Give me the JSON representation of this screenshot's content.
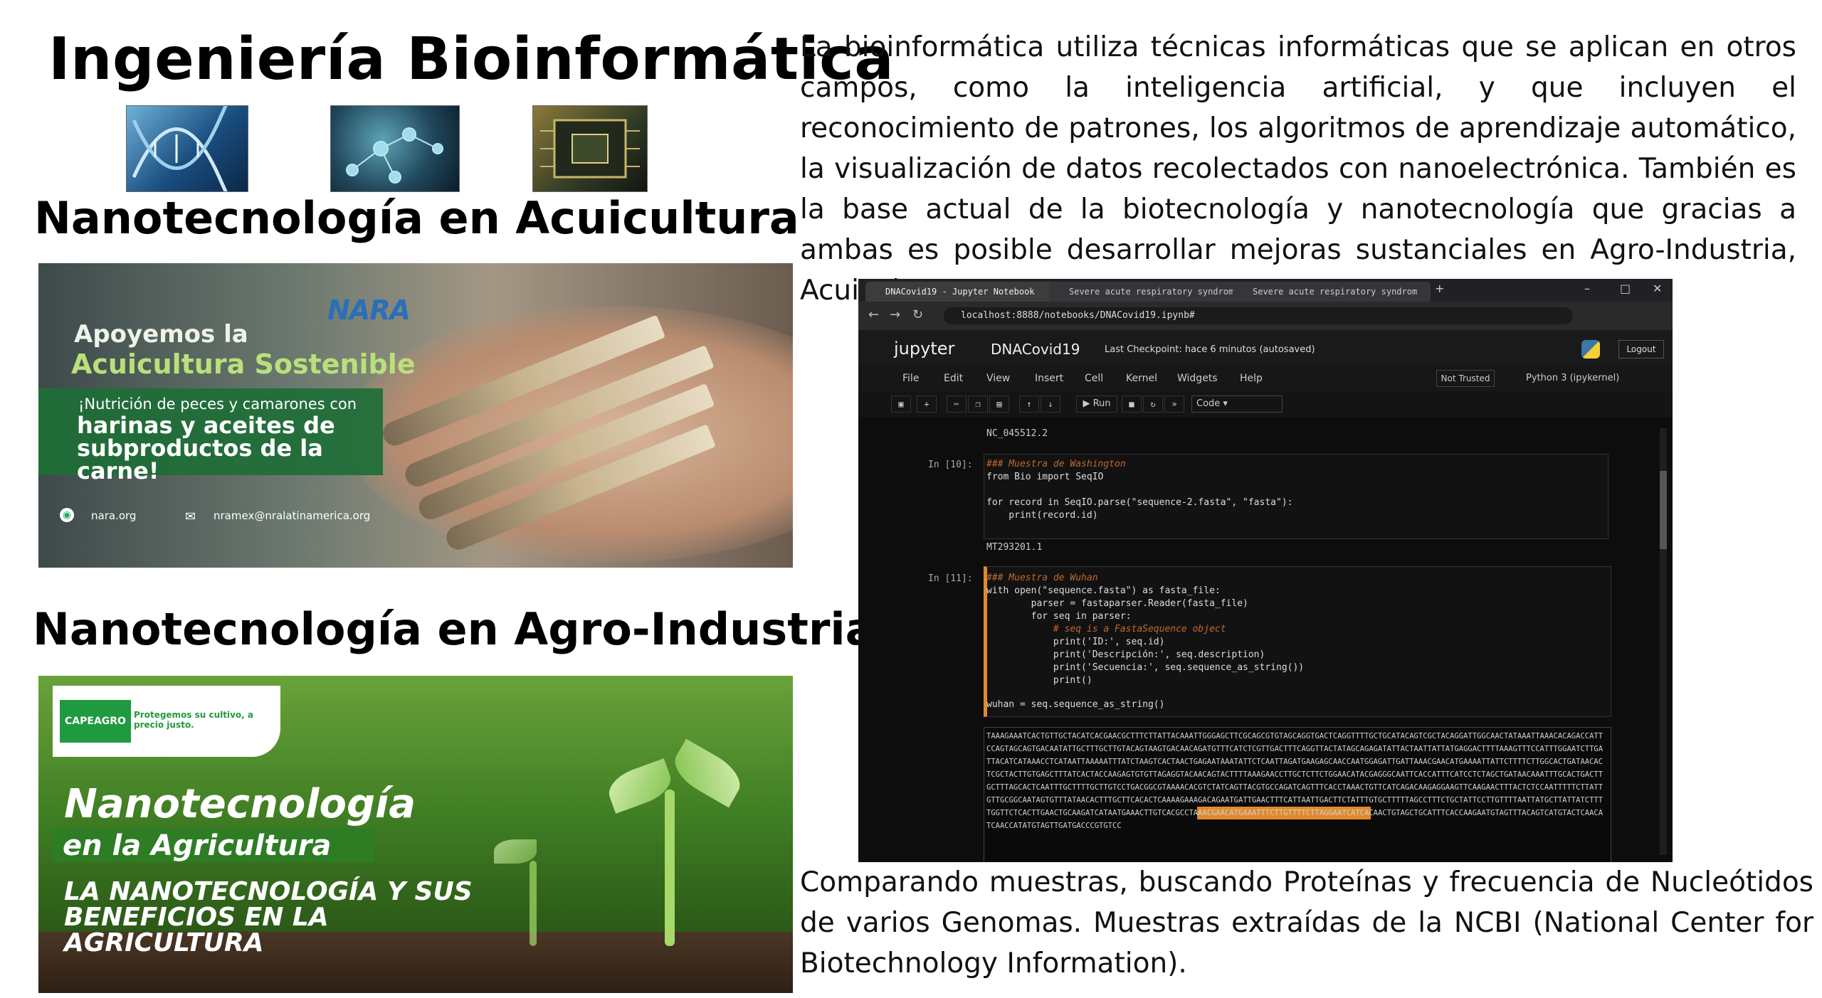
{
  "title": "Ingeniería Bioinformática",
  "paragraph_top": "La bioinformática utiliza técnicas informáticas que se aplican en otros campos, como la inteligencia artificial, y que incluyen el reconocimiento de patrones, los algoritmos de aprendizaje automático, la visualización de datos recolectados con nanoelectrónica. También es la base actual de la biotecnología y nanotecnología que gracias a ambas es posible desarrollar mejoras sustanciales en Agro-Industria, Acuicultura, etc.",
  "paragraph_bottom": "Comparando muestras, buscando Proteínas y frecuencia de Nucleótidos de varios Genomas. Muestras extraídas de la NCBI (National Center for Biotechnology Information).",
  "section_acuicultura": "Nanotecnología en Acuicultura",
  "section_agro": "Nanotecnología en Agro-Industria",
  "banner_acuicultura": {
    "line1": "Apoyemos la",
    "line2": "Acuicultura Sostenible",
    "sub": "¡Nutrición de peces y camarones con",
    "big": "harinas y aceites de subproductos de la carne!",
    "logo": "NARA",
    "website": "nara.org",
    "email": "nramex@nralatinamerica.org"
  },
  "banner_agro": {
    "logo": "CAPEAGRO",
    "slogan": "Protegemos su cultivo, a precio justo.",
    "h1": "Nanotecnología",
    "h2": "en la Agricultura",
    "h3": "LA NANOTECNOLOGÍA Y SUS BENEFICIOS EN LA AGRICULTURA"
  },
  "jupyter": {
    "tabs": [
      "DNACovid19 - Jupyter Notebook",
      "Severe acute respiratory syndrom",
      "Severe acute respiratory syndrom"
    ],
    "url": "localhost:8888/notebooks/DNACovid19.ipynb#",
    "logo": "jupyter",
    "notebook_name": "DNACovid19",
    "checkpoint": "Last Checkpoint: hace 6 minutos  (autosaved)",
    "logout": "Logout",
    "menu": [
      "File",
      "Edit",
      "View",
      "Insert",
      "Cell",
      "Kernel",
      "Widgets",
      "Help"
    ],
    "trusted": "Not Trusted",
    "kernel": "Python 3 (ipykernel)",
    "run": "Run",
    "cell_type": "Code",
    "out_prev": "NC_045512.2",
    "prompt_10": "In [10]:",
    "code_10": {
      "l1": "### Muestra de Washington",
      "l2": "from Bio import SeqIO",
      "l3": "for record in SeqIO.parse(\"sequence-2.fasta\", \"fasta\"):",
      "l4": "    print(record.id)"
    },
    "out_10": "MT293201.1",
    "prompt_11": "In [11]:",
    "code_11": {
      "l1": "### Muestra de Wuhan",
      "l2": "with open(\"sequence.fasta\") as fasta_file:",
      "l3": "        parser = fastaparser.Reader(fasta_file)",
      "l4": "        for seq in parser:",
      "l5": "            # seq is a FastaSequence object",
      "l6": "            print('ID:', seq.id)",
      "l7": "            print('Descripción:', seq.description)",
      "l8": "            print('Secuencia:', seq.sequence_as_string())",
      "l9": "            print()",
      "l10": "wuhan = seq.sequence_as_string()"
    },
    "sequence": "TAAAGAAATCACTGTTGCTACATCACGAACGCTTTCTTATTACAAATTGGGAGCTTCGCAGCGTGTAGCAGGTGACTCAGGTTTTGCTGCATACAGTCGCTACAGGATTGGCAACTATAAATTAAACACAGACCATTCCAGTAGCAGTGACAATATTGCTTTGCTTGTACAGTAAGTGACAACAGATGTTTCATCTCGTTGACTTTCAGGTTACTATAGCAGAGATATTACTAATTATTATGAGGACTTTTAAAGTTTCCATTTGGAATCTTGATTACATCATAAACCTCATAATTAAAAATTTATCTAAGTCACTAACTGAGAATAAATATTCTCAATTAGATGAAGAGCAACCAATGGAGATTGATTAAACGAACATGAAAATTATTCTTTTCTTGGCACTGATAACACTCGCTACTTGTGAGCTTTATCACTACCAAGAGTGTGTTAGAGGTACAACAGTACTTTTAAAGAACCTTGCTCTTCTGGAACATACGAGGGCAATTCACCATTTCATCCTCTAGCTGATAACAAATTTGCACTGACTTGCTTTAGCACTCAATTTGCTTTTGCTTGTCCTGACGGCGTAAAACACGTCTATCAGTTACGTGCCAGATCAGTTTCACCTAAACTGTTCATCAGACAAGAGGAAGTTCAAGAACTTTACTCTCCAATTTTTCTTATTGTTGCGGCAATAGTGTTTATAACACTTTGCTTCACACTCAAAAGAAAGACAGAATGATTGAACTTTCATTAATTGACTTCTATTTGTGCTTTTTAGCCTTTCTGCTATTCCTTGTTTTAATTATGCTTATTATCTTTTGGTTCTCACTTGAACTGCAAGATCATAATGAAACTTGTCACGCCTAAACGAACATGAAATTTCTTGTTTTCTTAGGAATCATCACAACTGTAGCTGCATTTCACCAAGAATGTAGTTTACAGTCATGTACTCAACATCAACCATATGTAGTTGATGACCCGTGTCC"
  }
}
